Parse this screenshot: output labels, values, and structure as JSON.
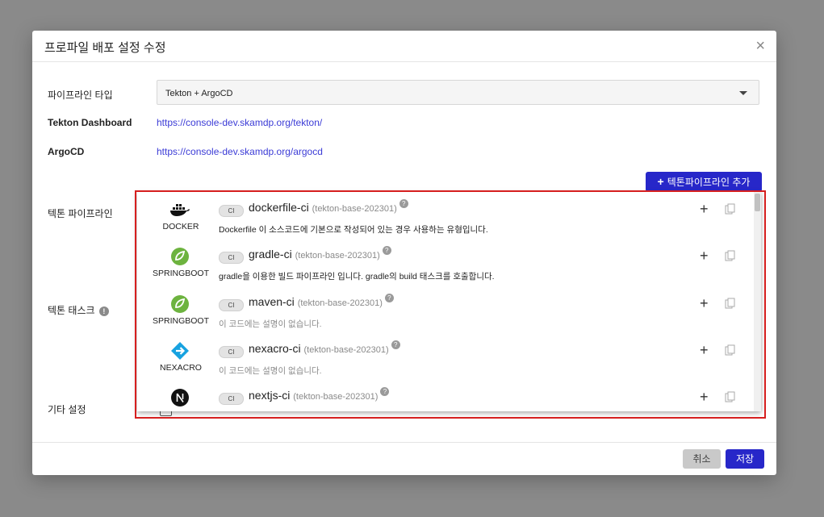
{
  "modal": {
    "title": "프로파일 배포 설정 수정",
    "close_icon": "close-icon",
    "fields": {
      "pipeline_type_label": "파이프라인 타입",
      "pipeline_type_value": "Tekton + ArgoCD",
      "tekton_dashboard_label": "Tekton Dashboard",
      "tekton_dashboard_url": "https://console-dev.skamdp.org/tekton/",
      "argocd_label": "ArgoCD",
      "argocd_url": "https://console-dev.skamdp.org/argocd",
      "tekton_pipeline_label": "텍톤 파이프라인",
      "tekton_task_label": "텍톤 태스크",
      "other_settings_label": "기타 설정"
    },
    "add_pipeline_button": "텍톤파이프라인 추가",
    "pipelines": [
      {
        "tech": "DOCKER",
        "icon": "docker-icon",
        "badge": "CI",
        "name": "dockerfile-ci",
        "version": "(tekton-base-202301)",
        "description": "Dockerfile 이 소스코드에 기본으로 작성되어 있는 경우 사용하는 유형입니다.",
        "has_description": true
      },
      {
        "tech": "SPRINGBOOT",
        "icon": "springboot-icon",
        "badge": "CI",
        "name": "gradle-ci",
        "version": "(tekton-base-202301)",
        "description": "gradle을 이용한 빌드 파이프라인 입니다. gradle의 build 태스크를 호출합니다.",
        "has_description": true
      },
      {
        "tech": "SPRINGBOOT",
        "icon": "springboot-icon",
        "badge": "CI",
        "name": "maven-ci",
        "version": "(tekton-base-202301)",
        "description": "이 코드에는 설명이 없습니다.",
        "has_description": false
      },
      {
        "tech": "NEXACRO",
        "icon": "nexacro-icon",
        "badge": "CI",
        "name": "nexacro-ci",
        "version": "(tekton-base-202301)",
        "description": "이 코드에는 설명이 없습니다.",
        "has_description": false
      },
      {
        "tech": "",
        "icon": "nextjs-icon",
        "badge": "CI",
        "name": "nextjs-ci",
        "version": "(tekton-base-202301)",
        "description": "",
        "has_description": false
      }
    ],
    "cancel_button": "취소",
    "save_button": "저장"
  },
  "colors": {
    "primary": "#2727c9",
    "link": "#3b3bd6",
    "highlight_border": "#d61f1f"
  }
}
